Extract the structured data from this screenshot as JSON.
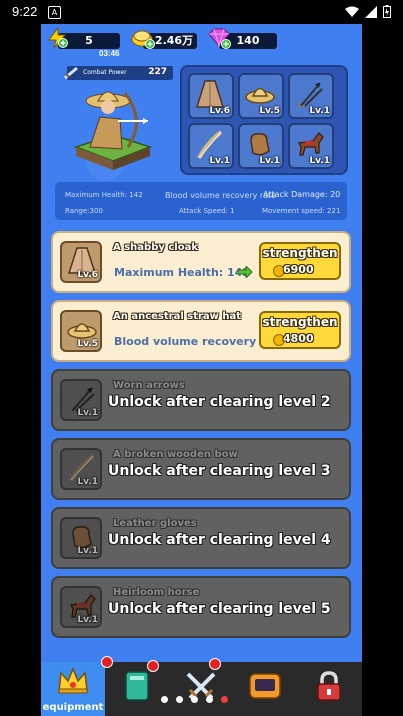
{
  "status_bar": {
    "time": "9:22"
  },
  "resources": {
    "energy": "5",
    "energy_timer": "03:46",
    "gold": "2.46万",
    "gems": "140"
  },
  "hero": {
    "combat_power_label": "Combat Power",
    "combat_power": "227"
  },
  "slots": [
    {
      "icon": "cloak-icon",
      "level": "Lv.6"
    },
    {
      "icon": "straw-hat-icon",
      "level": "Lv.5"
    },
    {
      "icon": "arrows-icon",
      "level": "Lv.1"
    },
    {
      "icon": "bow-icon",
      "level": "Lv.1"
    },
    {
      "icon": "gloves-icon",
      "level": "Lv.1"
    },
    {
      "icon": "horse-icon",
      "level": "Lv.1"
    }
  ],
  "stats": {
    "max_health": "Maximum Health: 142",
    "blood_recovery": "Blood volume recovery rate",
    "attack_damage": "Attack Damage: 20",
    "range": "Range:300",
    "attack_speed": "Attack Speed: 1",
    "movement_speed": "Movement speed: 221"
  },
  "equipment": [
    {
      "name": "A shabby cloak",
      "level": "Lv.6",
      "attribute": "Maximum Health: 142",
      "button": "strengthen",
      "cost": "6900",
      "locked": false
    },
    {
      "name": "An ancestral straw hat",
      "level": "Lv.5",
      "attribute": "Blood volume recovery rate",
      "button": "strengthen",
      "cost": "4800",
      "locked": false
    },
    {
      "name": "Worn arrows",
      "level": "Lv.1",
      "lock_text": "Unlock after clearing level 2",
      "locked": true
    },
    {
      "name": "A broken wooden bow",
      "level": "Lv.1",
      "lock_text": "Unlock after clearing level 3",
      "locked": true
    },
    {
      "name": "Leather gloves",
      "level": "Lv.1",
      "lock_text": "Unlock after clearing level 4",
      "locked": true
    },
    {
      "name": "Heirloom horse",
      "level": "Lv.1",
      "lock_text": "Unlock after clearing level 5",
      "locked": true
    }
  ],
  "tabs": [
    {
      "label": "equipment",
      "icon": "crown-icon",
      "active": true
    },
    {
      "label": "",
      "icon": "book-icon",
      "active": false
    },
    {
      "label": "",
      "icon": "crossed-swords-icon",
      "active": false
    },
    {
      "label": "",
      "icon": "tablet-icon",
      "active": false
    },
    {
      "label": "",
      "icon": "lock-icon",
      "active": false
    }
  ],
  "colors": {
    "background": "#3f7ff0",
    "card_unlocked": "#fbeed1",
    "card_locked": "#616161",
    "button": "#ffd83a"
  }
}
